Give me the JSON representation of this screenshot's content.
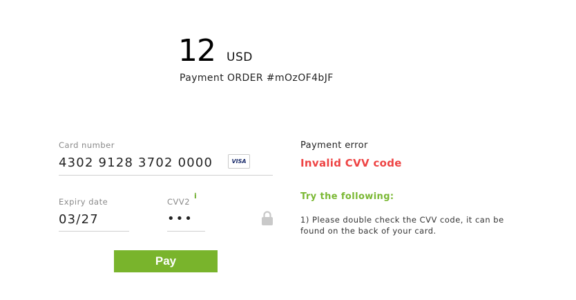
{
  "payment": {
    "amount": "12",
    "currency": "USD",
    "order_text": "Payment ORDER #mOzOF4bJF"
  },
  "card_form": {
    "card_number_label": "Card number",
    "card_number_value": "4302 9128 3702 0000",
    "card_brand": "VISA",
    "expiry_label": "Expiry date",
    "expiry_value": "03/27",
    "cvv_label": "CVV2",
    "cvv_info_marker": "i",
    "cvv_value_masked": "•••",
    "lock_icon": "lock-icon"
  },
  "actions": {
    "pay_label": "Pay"
  },
  "error_panel": {
    "title": "Payment error",
    "message": "Invalid CVV code",
    "suggestions_title": "Try the following:",
    "suggestions": [
      "1) Please double check the CVV code, it can be found on the back of your card."
    ]
  },
  "colors": {
    "accent_green": "#79b42c",
    "error_red": "#ee4444"
  }
}
